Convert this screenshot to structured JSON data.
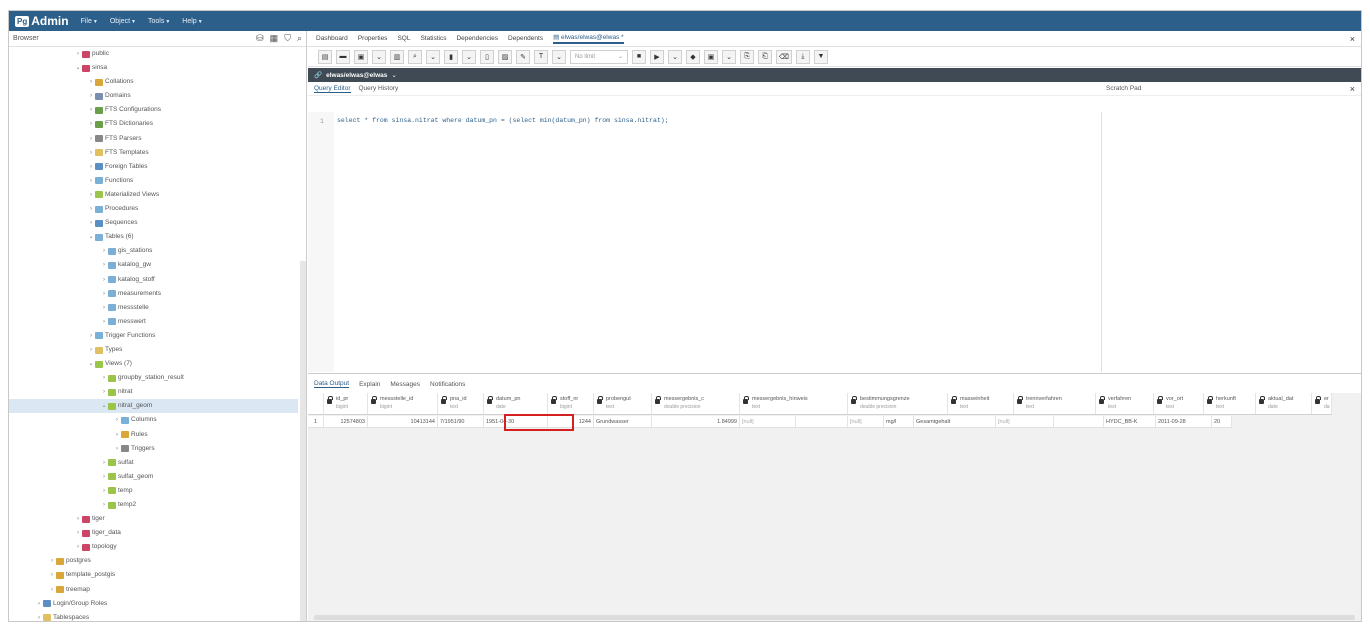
{
  "menubar": {
    "logo_prefix": "Pg",
    "logo_text": "Admin",
    "items": [
      "File",
      "Object",
      "Tools",
      "Help"
    ]
  },
  "browser": {
    "title": "Browser",
    "tree": [
      {
        "label": "public",
        "indent": 5,
        "arrow": "›",
        "icon_color": "#c46",
        "selected": false
      },
      {
        "label": "sinsa",
        "indent": 5,
        "arrow": "⌄",
        "icon_color": "#c46",
        "selected": false
      },
      {
        "label": "Collations",
        "indent": 6,
        "arrow": "›",
        "icon_color": "#d9a63a",
        "selected": false
      },
      {
        "label": "Domains",
        "indent": 6,
        "arrow": "›",
        "icon_color": "#7a8fb0",
        "selected": false
      },
      {
        "label": "FTS Configurations",
        "indent": 6,
        "arrow": "›",
        "icon_color": "#6b9e4b",
        "selected": false
      },
      {
        "label": "FTS Dictionaries",
        "indent": 6,
        "arrow": "›",
        "icon_color": "#6b9e4b",
        "selected": false
      },
      {
        "label": "FTS Parsers",
        "indent": 6,
        "arrow": "›",
        "icon_color": "#888",
        "selected": false
      },
      {
        "label": "FTS Templates",
        "indent": 6,
        "arrow": "›",
        "icon_color": "#e0c060",
        "selected": false
      },
      {
        "label": "Foreign Tables",
        "indent": 6,
        "arrow": "›",
        "icon_color": "#5b8fc4",
        "selected": false
      },
      {
        "label": "Functions",
        "indent": 6,
        "arrow": "›",
        "icon_color": "#7ab0d8",
        "selected": false
      },
      {
        "label": "Materialized Views",
        "indent": 6,
        "arrow": "›",
        "icon_color": "#9ac44a",
        "selected": false
      },
      {
        "label": "Procedures",
        "indent": 6,
        "arrow": "›",
        "icon_color": "#7ab0d8",
        "selected": false
      },
      {
        "label": "Sequences",
        "indent": 6,
        "arrow": "›",
        "icon_color": "#5b8fc4",
        "selected": false
      },
      {
        "label": "Tables (6)",
        "indent": 6,
        "arrow": "⌄",
        "icon_color": "#7ab0d8",
        "selected": false
      },
      {
        "label": "gis_stations",
        "indent": 7,
        "arrow": "›",
        "icon_color": "#7ab0d8",
        "selected": false
      },
      {
        "label": "katalog_gw",
        "indent": 7,
        "arrow": "›",
        "icon_color": "#7ab0d8",
        "selected": false
      },
      {
        "label": "katalog_stoff",
        "indent": 7,
        "arrow": "›",
        "icon_color": "#7ab0d8",
        "selected": false
      },
      {
        "label": "measurements",
        "indent": 7,
        "arrow": "›",
        "icon_color": "#7ab0d8",
        "selected": false
      },
      {
        "label": "messstelle",
        "indent": 7,
        "arrow": "›",
        "icon_color": "#7ab0d8",
        "selected": false
      },
      {
        "label": "messwert",
        "indent": 7,
        "arrow": "›",
        "icon_color": "#7ab0d8",
        "selected": false
      },
      {
        "label": "Trigger Functions",
        "indent": 6,
        "arrow": "›",
        "icon_color": "#7ab0d8",
        "selected": false
      },
      {
        "label": "Types",
        "indent": 6,
        "arrow": "›",
        "icon_color": "#e0c060",
        "selected": false
      },
      {
        "label": "Views (7)",
        "indent": 6,
        "arrow": "⌄",
        "icon_color": "#9ac44a",
        "selected": false
      },
      {
        "label": "groupby_station_result",
        "indent": 7,
        "arrow": "›",
        "icon_color": "#9ac44a",
        "selected": false
      },
      {
        "label": "nitrat",
        "indent": 7,
        "arrow": "›",
        "icon_color": "#9ac44a",
        "selected": false
      },
      {
        "label": "nitrat_geom",
        "indent": 7,
        "arrow": "⌄",
        "icon_color": "#9ac44a",
        "selected": true
      },
      {
        "label": "Columns",
        "indent": 8,
        "arrow": "›",
        "icon_color": "#7ab0d8",
        "selected": false
      },
      {
        "label": "Rules",
        "indent": 8,
        "arrow": "›",
        "icon_color": "#d9a63a",
        "selected": false
      },
      {
        "label": "Triggers",
        "indent": 8,
        "arrow": "›",
        "icon_color": "#888",
        "selected": false
      },
      {
        "label": "sulfat",
        "indent": 7,
        "arrow": "›",
        "icon_color": "#9ac44a",
        "selected": false
      },
      {
        "label": "sulfat_geom",
        "indent": 7,
        "arrow": "›",
        "icon_color": "#9ac44a",
        "selected": false
      },
      {
        "label": "temp",
        "indent": 7,
        "arrow": "›",
        "icon_color": "#9ac44a",
        "selected": false
      },
      {
        "label": "temp2",
        "indent": 7,
        "arrow": "›",
        "icon_color": "#9ac44a",
        "selected": false
      },
      {
        "label": "tiger",
        "indent": 5,
        "arrow": "›",
        "icon_color": "#c46",
        "selected": false
      },
      {
        "label": "tiger_data",
        "indent": 5,
        "arrow": "›",
        "icon_color": "#c46",
        "selected": false
      },
      {
        "label": "topology",
        "indent": 5,
        "arrow": "›",
        "icon_color": "#c46",
        "selected": false
      },
      {
        "label": "postgres",
        "indent": 3,
        "arrow": "›",
        "icon_color": "#d9a63a",
        "selected": false
      },
      {
        "label": "template_postgis",
        "indent": 3,
        "arrow": "›",
        "icon_color": "#d9a63a",
        "selected": false
      },
      {
        "label": "treemap",
        "indent": 3,
        "arrow": "›",
        "icon_color": "#d9a63a",
        "selected": false
      },
      {
        "label": "Login/Group Roles",
        "indent": 2,
        "arrow": "›",
        "icon_color": "#5b8fc4",
        "selected": false
      },
      {
        "label": "Tablespaces",
        "indent": 2,
        "arrow": "›",
        "icon_color": "#e0c060",
        "selected": false
      }
    ]
  },
  "tabs": [
    "Dashboard",
    "Properties",
    "SQL",
    "Statistics",
    "Dependencies",
    "Dependents"
  ],
  "active_tab": "elwas/elwas@elwas *",
  "toolbar": {
    "limit_label": "No limit"
  },
  "connection": "elwas/elwas@elwas",
  "editor": {
    "tabs": [
      "Query Editor",
      "Query History"
    ],
    "scratch_pad": "Scratch Pad",
    "line_number": "1",
    "sql": "select * from sinsa.nitrat where datum_pn = (select min(datum_pn) from sinsa.nitrat);"
  },
  "results": {
    "tabs": [
      "Data Output",
      "Explain",
      "Messages",
      "Notifications"
    ],
    "columns": [
      {
        "name": "id_pr",
        "type": "bigint"
      },
      {
        "name": "messstelle_id",
        "type": "bigint"
      },
      {
        "name": "pna_id",
        "type": "text"
      },
      {
        "name": "datum_pn",
        "type": "date"
      },
      {
        "name": "stoff_nr",
        "type": "bigint"
      },
      {
        "name": "probengut",
        "type": "text"
      },
      {
        "name": "messergebnis_c",
        "type": "double precision"
      },
      {
        "name": "messergebnis_hinweis",
        "type": "text"
      },
      {
        "name": "bestimmungsgrenze",
        "type": "double precision"
      },
      {
        "name": "masseinheit",
        "type": "text"
      },
      {
        "name": "trennverfahren",
        "type": "text"
      },
      {
        "name": "verfahren",
        "type": "text"
      },
      {
        "name": "vor_ort",
        "type": "text"
      },
      {
        "name": "herkunft",
        "type": "text"
      },
      {
        "name": "aktual_dat",
        "type": "date"
      },
      {
        "name": "er",
        "type": "da"
      }
    ],
    "row": {
      "index": "1",
      "cells": [
        "12574803",
        "10413144",
        "7/1951/90",
        "1951-04-30",
        "1244",
        "Grundwasser",
        "1.84999",
        "[null]",
        "",
        "[null]",
        "mg/l",
        "Gesamtgehalt",
        "[null]",
        "",
        "HYDC_BB-K",
        "2011-09-28",
        "20"
      ]
    }
  }
}
